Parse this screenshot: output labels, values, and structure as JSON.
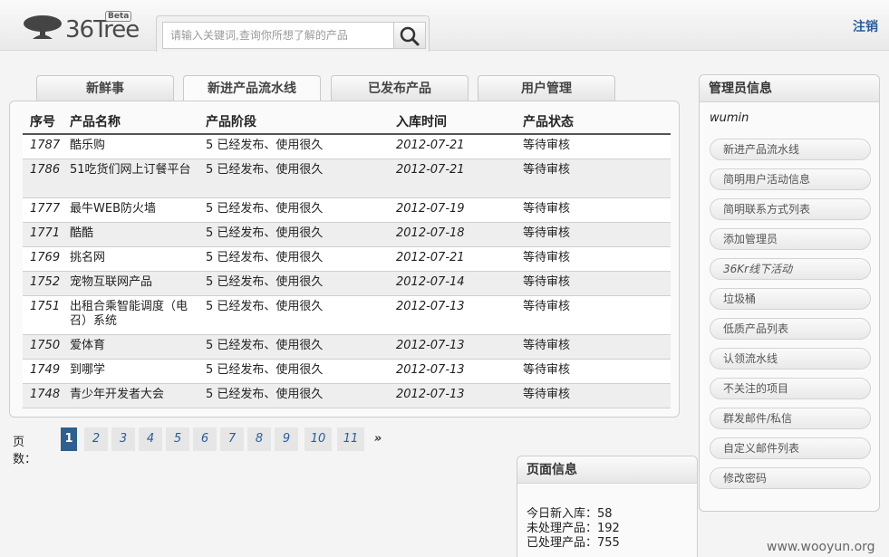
{
  "header": {
    "logo_text": "36Tree",
    "logo_badge": "Beta",
    "search_placeholder": "请输入关键词,查询你所想了解的产品",
    "logout_label": "注销",
    "logo_icon": "tree-icon",
    "search_icon": "search-icon"
  },
  "tabs": [
    {
      "label": "新鲜事",
      "active": false
    },
    {
      "label": "新进产品流水线",
      "active": true
    },
    {
      "label": "已发布产品",
      "active": false
    },
    {
      "label": "用户管理",
      "active": false
    }
  ],
  "table": {
    "headers": [
      "序号",
      "产品名称",
      "产品阶段",
      "入库时间",
      "产品状态"
    ],
    "rows": [
      {
        "id": "1787",
        "name": "酷乐购",
        "stage": "5 已经发布、使用很久",
        "date": "2012-07-21",
        "status": "等待审核"
      },
      {
        "id": "1786",
        "name": "51吃货们网上订餐平台",
        "stage": "5 已经发布、使用很久",
        "date": "2012-07-21",
        "status": "等待审核"
      },
      {
        "id": "1777",
        "name": "最牛WEB防火墙",
        "stage": "5 已经发布、使用很久",
        "date": "2012-07-19",
        "status": "等待审核"
      },
      {
        "id": "1771",
        "name": "酷酷",
        "stage": "5 已经发布、使用很久",
        "date": "2012-07-18",
        "status": "等待审核"
      },
      {
        "id": "1769",
        "name": "挑名网",
        "stage": "5 已经发布、使用很久",
        "date": "2012-07-21",
        "status": "等待审核"
      },
      {
        "id": "1752",
        "name": "宠物互联网产品",
        "stage": "5 已经发布、使用很久",
        "date": "2012-07-14",
        "status": "等待审核"
      },
      {
        "id": "1751",
        "name": "出租合乘智能调度（电召）系统",
        "stage": "5 已经发布、使用很久",
        "date": "2012-07-13",
        "status": "等待审核"
      },
      {
        "id": "1750",
        "name": "爱体育",
        "stage": "5 已经发布、使用很久",
        "date": "2012-07-13",
        "status": "等待审核"
      },
      {
        "id": "1749",
        "name": "到哪学",
        "stage": "5 已经发布、使用很久",
        "date": "2012-07-13",
        "status": "等待审核"
      },
      {
        "id": "1748",
        "name": "青少年开发者大会",
        "stage": "5 已经发布、使用很久",
        "date": "2012-07-13",
        "status": "等待审核"
      }
    ]
  },
  "pager": {
    "label": "页数：",
    "pages": [
      "1",
      "2",
      "3",
      "4",
      "5",
      "6",
      "7",
      "8",
      "9",
      "10",
      "11"
    ],
    "current": "1",
    "next": "»"
  },
  "page_info": {
    "title": "页面信息",
    "lines": [
      "今日新入库：58",
      "未处理产品：192",
      "已处理产品：755"
    ]
  },
  "admin": {
    "title": "管理员信息",
    "username": "wumin",
    "links": [
      "新进产品流水线",
      "简明用户活动信息",
      "简明联系方式列表",
      "添加管理员",
      "36Kr线下活动",
      "垃圾桶",
      "低质产品列表",
      "认领流水线",
      "不关注的项目",
      "群发邮件/私信",
      "自定义邮件列表",
      "修改密码"
    ]
  },
  "watermark": "www.wooyun.org",
  "colors": {
    "accent": "#2f5f8c",
    "link": "#2a5d9a"
  }
}
